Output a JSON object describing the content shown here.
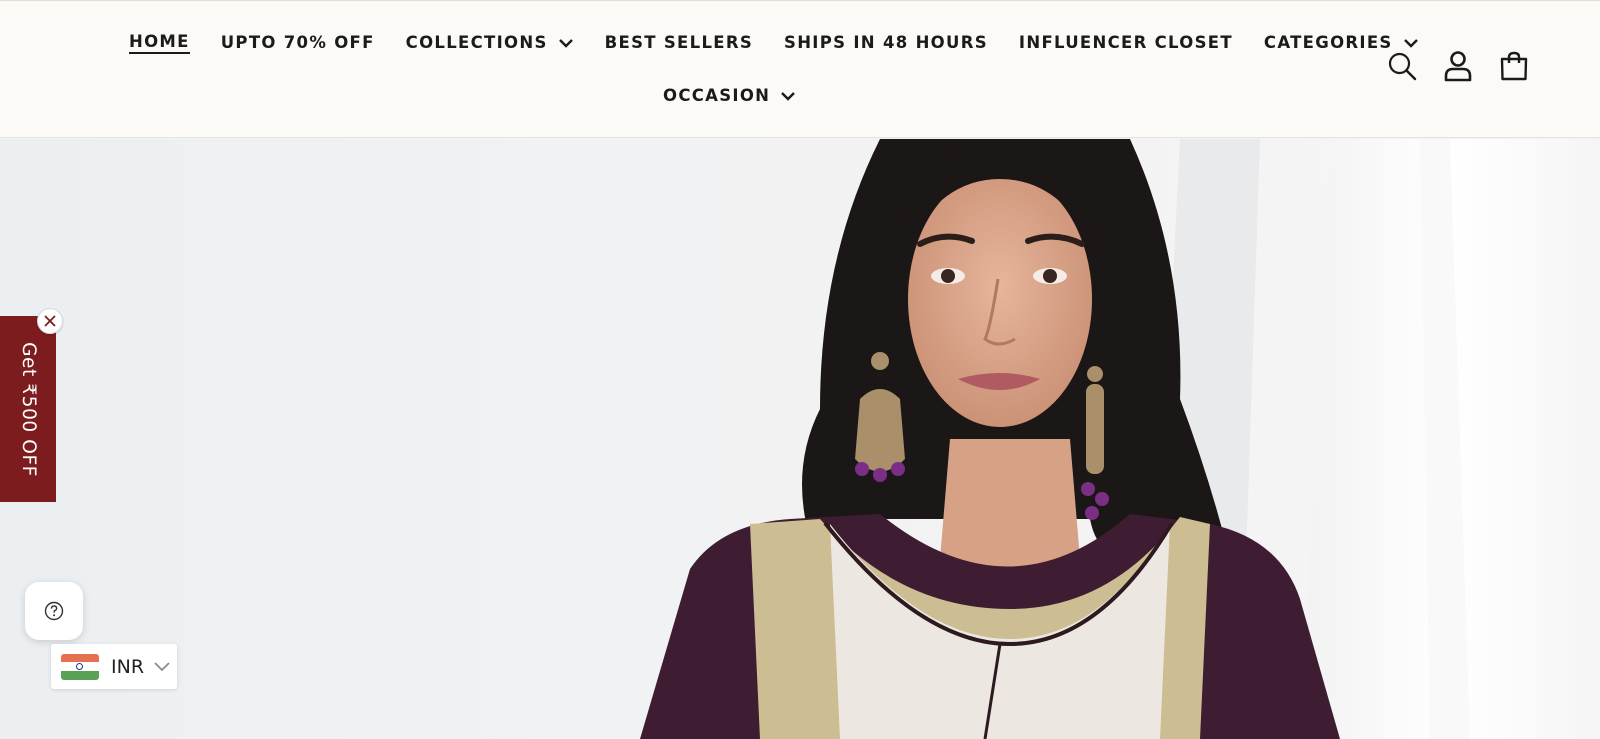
{
  "nav": {
    "row1": [
      {
        "label": "HOME",
        "active": true,
        "dropdown": false
      },
      {
        "label": "UPTO 70% OFF",
        "active": false,
        "dropdown": false
      },
      {
        "label": "COLLECTIONS",
        "active": false,
        "dropdown": true
      },
      {
        "label": "BEST SELLERS",
        "active": false,
        "dropdown": false
      },
      {
        "label": "SHIPS IN 48 HOURS",
        "active": false,
        "dropdown": false
      },
      {
        "label": "INFLUENCER CLOSET",
        "active": false,
        "dropdown": false
      },
      {
        "label": "CATEGORIES",
        "active": false,
        "dropdown": true
      }
    ],
    "row2": [
      {
        "label": "OCCASION",
        "active": false,
        "dropdown": true
      }
    ]
  },
  "header_icons": [
    "search-icon",
    "account-icon",
    "cart-icon"
  ],
  "promo": {
    "text": "Get ₹500 OFF",
    "color": "#7c1c1e"
  },
  "help": {
    "icon": "help-icon"
  },
  "currency": {
    "code": "INR",
    "flag": "india-flag-icon"
  },
  "colors": {
    "header_bg": "#fbfaf6",
    "text": "#1b1b1b",
    "garment": "#3e1d33",
    "embroidery": "#cdbd92"
  }
}
